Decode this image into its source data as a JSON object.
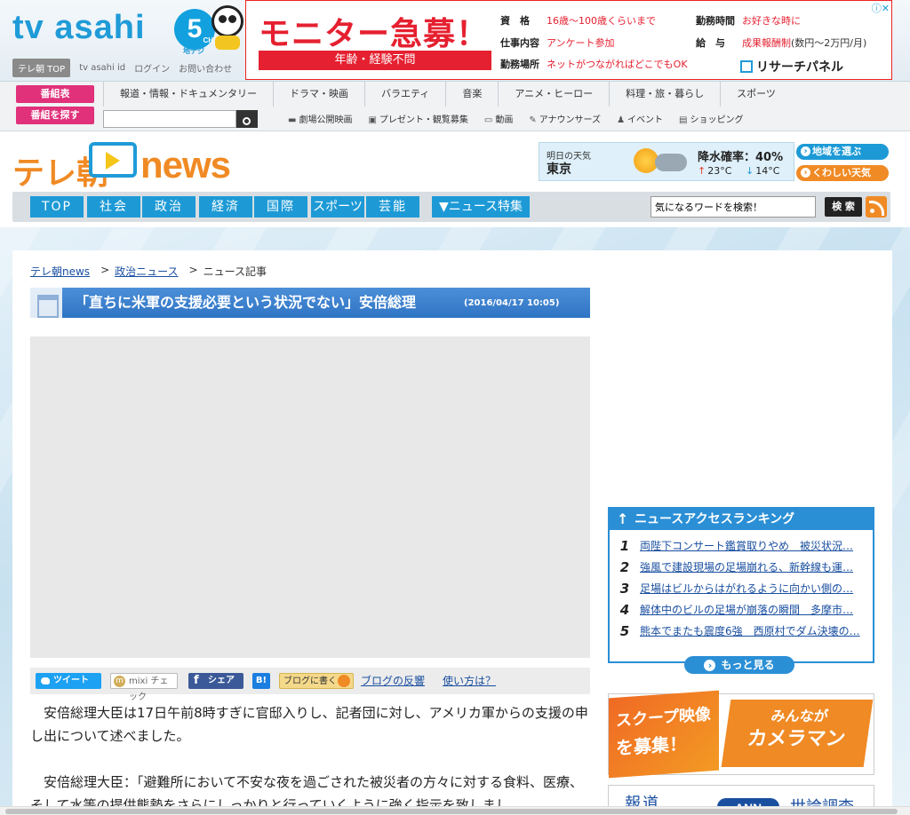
{
  "header": {
    "logo_text": "tv asahi",
    "logo_channel": "5",
    "logo_channel_suffix": "CH",
    "logo_chideji": "地デジ",
    "top_links": [
      "テレ朝 TOP",
      "tv asahi id",
      "ログイン",
      "お問い合わせ"
    ]
  },
  "ad": {
    "headline": "モニター急募！",
    "sub": "年齢・経験不問",
    "rows": [
      {
        "k": "資　格",
        "v": "16歳〜100歳くらいまで"
      },
      {
        "k": "仕事内容",
        "v": "アンケート参加"
      },
      {
        "k": "勤務場所",
        "v": "ネットがつながればどこでもOK"
      },
      {
        "k": "勤務時間",
        "v": "お好きな時に"
      },
      {
        "k": "給　与",
        "v": "成果報酬制",
        "v2": "(数円〜2万円/月)"
      }
    ],
    "brand": "リサーチパネル",
    "close": "ⓘ✕"
  },
  "global_nav": {
    "schedule_btn": "番組表",
    "find_btn": "番組を探す",
    "genres": [
      "報道・情報・ドキュメンタリー",
      "ドラマ・映画",
      "バラエティ",
      "音楽",
      "アニメ・ヒーロー",
      "料理・旅・暮らし",
      "スポーツ"
    ],
    "search_placeholder": "",
    "sub_links": [
      {
        "icon": "▬",
        "label": "劇場公開映画"
      },
      {
        "icon": "▣",
        "label": "プレゼント・観覧募集"
      },
      {
        "icon": "▭",
        "label": "動画"
      },
      {
        "icon": "✎",
        "label": "アナウンサーズ"
      },
      {
        "icon": "♟",
        "label": "イベント"
      },
      {
        "icon": "▤",
        "label": "ショッピング"
      }
    ]
  },
  "news_header": {
    "logo_prefix": "テレ朝",
    "logo_word": "news",
    "weather": {
      "label": "明日の天気",
      "city": "東京",
      "rain": "降水確率：40%",
      "high": "23°C",
      "low": "14°C",
      "region_btn": "地域を選ぶ",
      "detail_btn": "くわしい天気"
    },
    "categories": [
      "TOP",
      "社会",
      "政治",
      "経済",
      "国際",
      "スポーツ",
      "芸能",
      "▼ニュース特集"
    ],
    "search_placeholder": "気になるワードを検索！",
    "search_btn": "検 索"
  },
  "breadcrumb": {
    "home": "テレ朝news",
    "section": "政治ニュース",
    "current": "ニュース記事",
    "sep": ">"
  },
  "article": {
    "title": "「直ちに米軍の支援必要という状況でない」安倍総理",
    "date": "(2016/04/17 10:05)",
    "share": {
      "tweet": "ツイート",
      "mixi": "mixi チェック",
      "facebook": "シェア",
      "hatena": "B!",
      "blog": "ブログに書く",
      "reaction": "ブログの反響",
      "howto": "使い方は？"
    },
    "paragraphs": [
      "安倍総理大臣は17日午前8時すぎに官邸入りし、記者団に対し、アメリカ軍からの支援の申し出について述べました。",
      "安倍総理大臣：「避難所において不安な夜を過ごされた被災者の方々に対する食料、医療、そして水等の提供態勢をさらにしっかりと行っていくように強く指示を致しまし"
    ]
  },
  "ranking": {
    "title": "ニュースアクセスランキング",
    "items": [
      {
        "rank": "1",
        "text": "両陛下コンサート鑑賞取りやめ　被災状況…"
      },
      {
        "rank": "2",
        "text": "強風で建設現場の足場崩れる、新幹線も運…"
      },
      {
        "rank": "3",
        "text": "足場はビルからはがれるように向かい側の…"
      },
      {
        "rank": "4",
        "text": "解体中のビルの足場が崩落の瞬間　多摩市…"
      },
      {
        "rank": "5",
        "text": "熊本でまたも震度6強　西原村でダム決壊の…"
      }
    ],
    "more": "もっと見る"
  },
  "scoop_ad": {
    "left_line1": "スクープ映像",
    "left_line2": "を募集！",
    "right_line1": "みんなが",
    "right_line2": "カメラマン"
  },
  "bottom_box": {
    "label": "報道",
    "ann": "ANN",
    "poll": "世論調査"
  },
  "colors": {
    "brand_blue": "#1d9ad6",
    "brand_orange": "#f08a24",
    "ad_red": "#e52030",
    "pink": "#e0317a"
  }
}
